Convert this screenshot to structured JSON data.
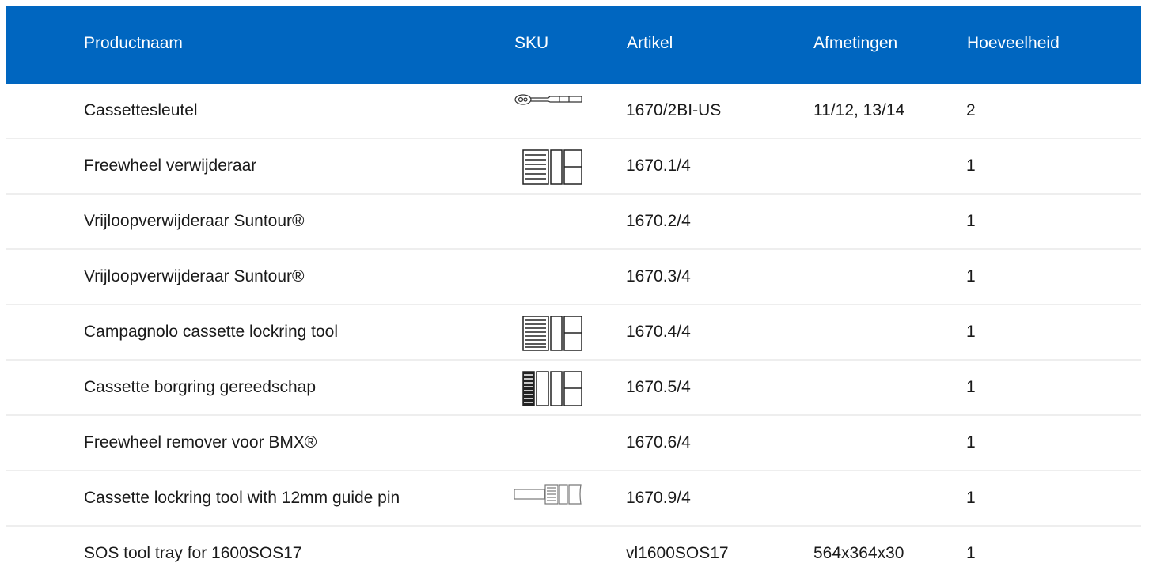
{
  "header": {
    "col_name": "Productnaam",
    "col_sku": "SKU",
    "col_article": "Artikel",
    "col_dimensions": "Afmetingen",
    "col_quantity": "Hoeveelheid",
    "background_color": "#0066c0"
  },
  "rows": [
    {
      "name": "Cassettesleutel",
      "sku_icon": "ratchet-wrench-icon",
      "article": "1670/2BI-US",
      "dimensions": "11/12, 13/14",
      "quantity": "2"
    },
    {
      "name": "Freewheel verwijderaar",
      "sku_icon": "splined-socket-icon",
      "article": "1670.1/4",
      "dimensions": "",
      "quantity": "1"
    },
    {
      "name": "Vrijloopverwijderaar Suntour®",
      "sku_icon": "",
      "article": "1670.2/4",
      "dimensions": "",
      "quantity": "1"
    },
    {
      "name": "Vrijloopverwijderaar Suntour®",
      "sku_icon": "",
      "article": "1670.3/4",
      "dimensions": "",
      "quantity": "1"
    },
    {
      "name": "Campagnolo cassette lockring tool",
      "sku_icon": "splined-socket-icon",
      "article": "1670.4/4",
      "dimensions": "",
      "quantity": "1"
    },
    {
      "name": "Cassette borgring gereedschap",
      "sku_icon": "fine-splined-socket-icon",
      "article": "1670.5/4",
      "dimensions": "",
      "quantity": "1"
    },
    {
      "name": "Freewheel remover voor BMX®",
      "sku_icon": "",
      "article": "1670.6/4",
      "dimensions": "",
      "quantity": "1"
    },
    {
      "name": "Cassette lockring tool with 12mm guide pin",
      "sku_icon": "guide-pin-socket-icon",
      "article": "1670.9/4",
      "dimensions": "",
      "quantity": "1"
    },
    {
      "name": "SOS tool tray for 1600SOS17",
      "sku_icon": "",
      "article": "vl1600SOS17",
      "dimensions": "564x364x30",
      "quantity": "1"
    }
  ]
}
